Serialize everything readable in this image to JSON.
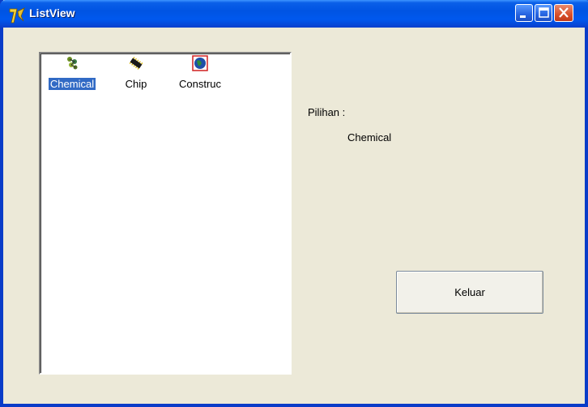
{
  "window": {
    "title": "ListView"
  },
  "listview": {
    "items": [
      {
        "label": "Chemical",
        "icon": "chemical-icon",
        "selected": true
      },
      {
        "label": "Chip",
        "icon": "chip-icon",
        "selected": false
      },
      {
        "label": "Construc",
        "icon": "construction-icon",
        "selected": false
      }
    ]
  },
  "selection": {
    "label": "Pilihan :",
    "value": "Chemical"
  },
  "buttons": {
    "exit_label": "Keluar"
  },
  "colors": {
    "titlebar": "#0054E3",
    "selection": "#316AC5",
    "face": "#ECE9D8"
  }
}
